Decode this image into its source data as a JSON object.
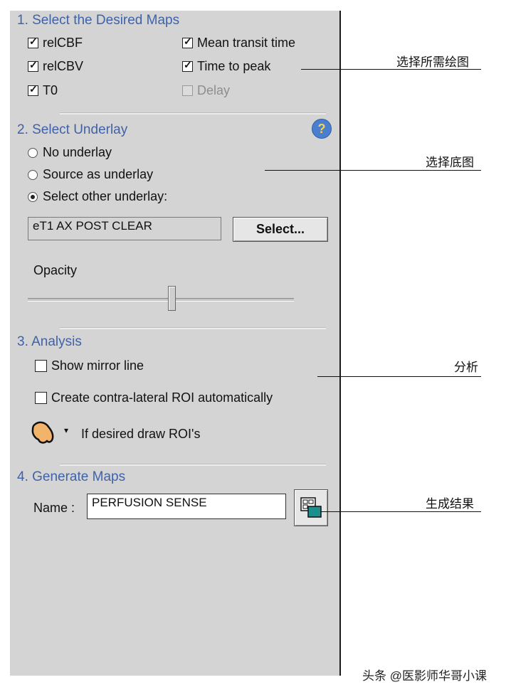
{
  "sections": {
    "maps": {
      "title": "1. Select the Desired Maps",
      "items": [
        {
          "label": "relCBF",
          "checked": true,
          "disabled": false
        },
        {
          "label": "Mean transit time",
          "checked": true,
          "disabled": false
        },
        {
          "label": "relCBV",
          "checked": true,
          "disabled": false
        },
        {
          "label": "Time to peak",
          "checked": true,
          "disabled": false
        },
        {
          "label": "T0",
          "checked": true,
          "disabled": false
        },
        {
          "label": "Delay",
          "checked": false,
          "disabled": true
        }
      ]
    },
    "underlay": {
      "title": "2. Select Underlay",
      "options": [
        {
          "label": "No underlay",
          "selected": false
        },
        {
          "label": "Source as underlay",
          "selected": false
        },
        {
          "label": "Select other underlay:",
          "selected": true
        }
      ],
      "field_value": "eT1 AX POST CLEAR",
      "select_button": "Select...",
      "opacity_label": "Opacity",
      "opacity_value": 0.55,
      "help_glyph": "?"
    },
    "analysis": {
      "title": "3. Analysis",
      "show_mirror_line": "Show mirror line",
      "create_contra": "Create contra-lateral ROI automatically",
      "roi_hint": "If desired draw ROI's",
      "roi_icon": "roi-draw-icon",
      "dropdown_glyph": "▾"
    },
    "generate": {
      "title": "4. Generate Maps",
      "name_label": "Name :",
      "name_value": "PERFUSION SENSE",
      "generate_icon": "generate-maps-icon"
    }
  },
  "annotations": [
    "选择所需绘图",
    "选择底图",
    "分析",
    "生成结果"
  ],
  "watermark": "头条 @医影师华哥小课",
  "colors": {
    "section_title": "#3f62a8",
    "panel_bg": "#d4d4d4"
  }
}
